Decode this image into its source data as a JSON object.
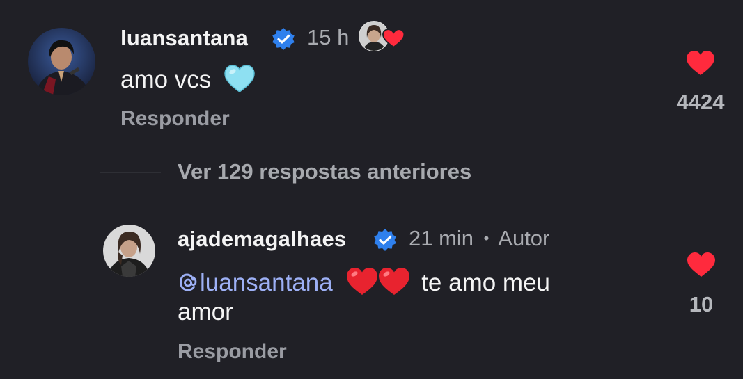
{
  "comments": [
    {
      "username": "luansantana",
      "verified": true,
      "time": "15 h",
      "liked_by_creator": true,
      "text": "amo vcs",
      "emoji": "light-blue-heart",
      "reply_label": "Responder",
      "like_count": "4424",
      "liked": true
    },
    {
      "username": "ajademagalhaes",
      "verified": true,
      "time": "21 min",
      "separator": "•",
      "author_label": "Autor",
      "mention": "@luansantana",
      "mention_display": "luansantana",
      "emoji": "two-red-hearts",
      "text_after": "te amo meu",
      "text_line2": "amor",
      "reply_label": "Responder",
      "like_count": "10",
      "liked": true
    }
  ],
  "view_replies_label": "Ver 129 respostas anteriores",
  "colors": {
    "background": "#202026",
    "verified": "#2f80ed",
    "like": "#ff2a3d",
    "mention": "#9db0f5",
    "muted": "#a9abb0"
  }
}
